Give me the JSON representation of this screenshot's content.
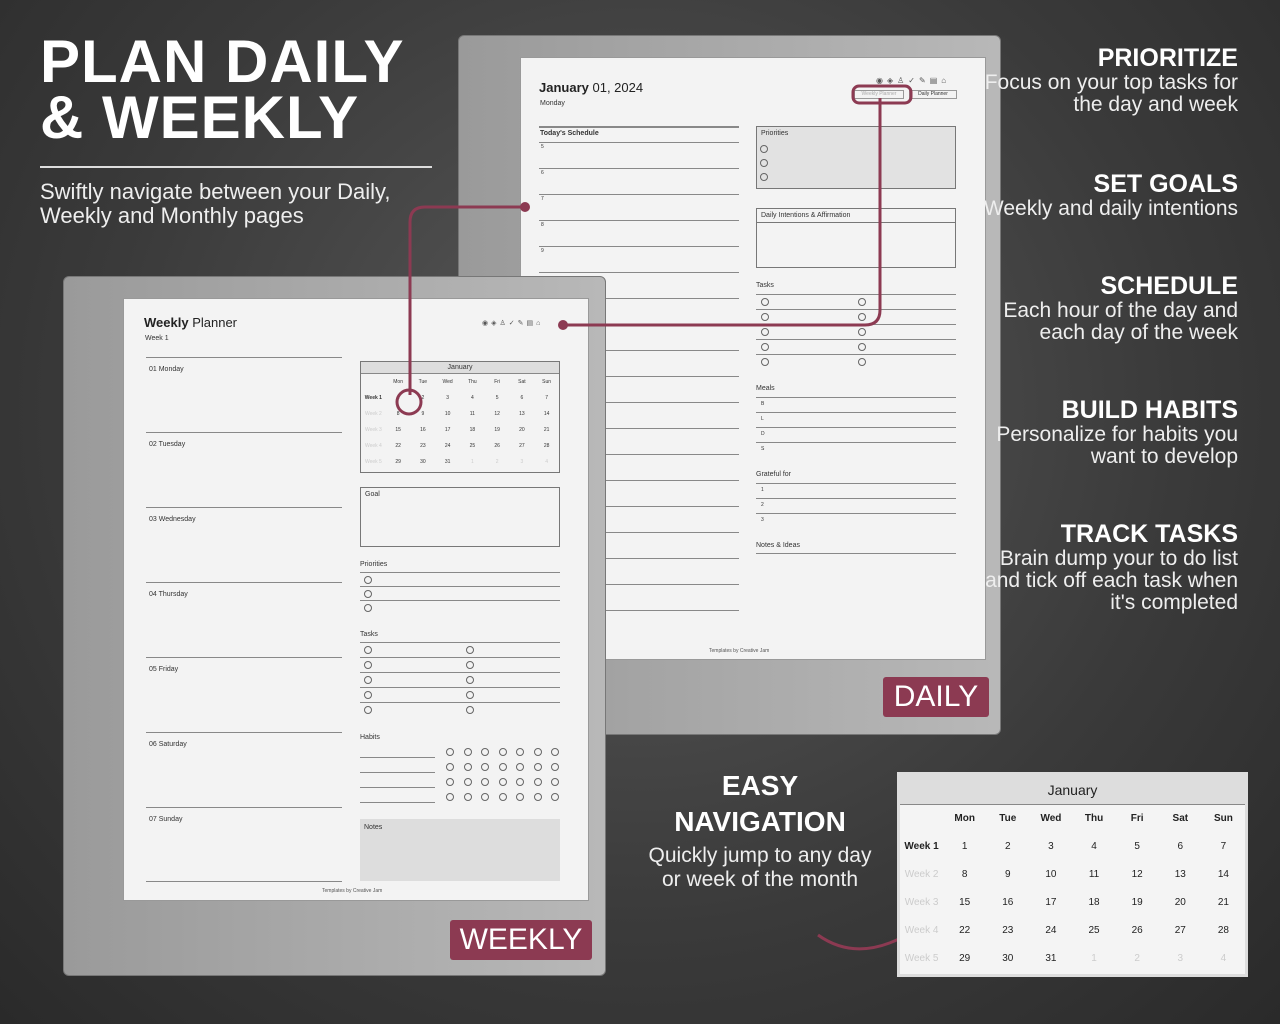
{
  "headline": {
    "line1": "PLAN DAILY",
    "line2": "& WEEKLY",
    "subtitle": "Swiftly navigate between your Daily, Weekly and Monthly pages"
  },
  "accent": "#8c3a52",
  "daily": {
    "date_month": "January",
    "date_rest": " 01, 2024",
    "weekday": "Monday",
    "schedule_title": "Today's Schedule",
    "hours": [
      "5",
      "6",
      "7",
      "8",
      "9"
    ],
    "priorities": "Priorities",
    "intentions": "Daily Intentions & Affirmation",
    "tasks": "Tasks",
    "meals": "Meals",
    "meal_rows": [
      "B",
      "L",
      "D",
      "S"
    ],
    "grateful": "Grateful for",
    "grateful_rows": [
      "1",
      "2",
      "3"
    ],
    "notes": "Notes & Ideas",
    "footer": "Templates by Creative Jam",
    "nav_weekly": "Weekly Planner",
    "nav_daily": "Daily Planner",
    "badge": "DAILY"
  },
  "weekly": {
    "title_bold": "Weekly",
    "title_rest": " Planner",
    "week": "Week 1",
    "days": [
      "01 Monday",
      "02 Tuesday",
      "03 Wednesday",
      "04 Thursday",
      "05 Friday",
      "06 Saturday",
      "07 Sunday"
    ],
    "calendar_month": "January",
    "goal": "Goal",
    "priorities": "Priorities",
    "tasks": "Tasks",
    "habits": "Habits",
    "notes": "Notes",
    "footer": "Templates by Creative Jam",
    "badge": "WEEKLY"
  },
  "calendar": {
    "month": "January",
    "headers": [
      "",
      "Mon",
      "Tue",
      "Wed",
      "Thu",
      "Fri",
      "Sat",
      "Sun"
    ],
    "rows": [
      [
        "Week 1",
        "1",
        "2",
        "3",
        "4",
        "5",
        "6",
        "7"
      ],
      [
        "Week 2",
        "8",
        "9",
        "10",
        "11",
        "12",
        "13",
        "14"
      ],
      [
        "Week 3",
        "15",
        "16",
        "17",
        "18",
        "19",
        "20",
        "21"
      ],
      [
        "Week 4",
        "22",
        "23",
        "24",
        "25",
        "26",
        "27",
        "28"
      ],
      [
        "Week 5",
        "29",
        "30",
        "31",
        "1",
        "2",
        "3",
        "4"
      ]
    ]
  },
  "features": [
    {
      "title": "PRIORITIZE",
      "text": "Focus on your top tasks for the day and week"
    },
    {
      "title": "SET GOALS",
      "text": "Weekly and daily intentions"
    },
    {
      "title": "SCHEDULE",
      "text": "Each hour of the day and each day of the week"
    },
    {
      "title": "BUILD HABITS",
      "text": "Personalize for habits you want to develop"
    },
    {
      "title": "TRACK TASKS",
      "text": "Brain dump your to do list and tick off each task when it's completed"
    }
  ],
  "navigation": {
    "title1": "EASY",
    "title2": "NAVIGATION",
    "text": "Quickly jump to any day or week of the month"
  }
}
